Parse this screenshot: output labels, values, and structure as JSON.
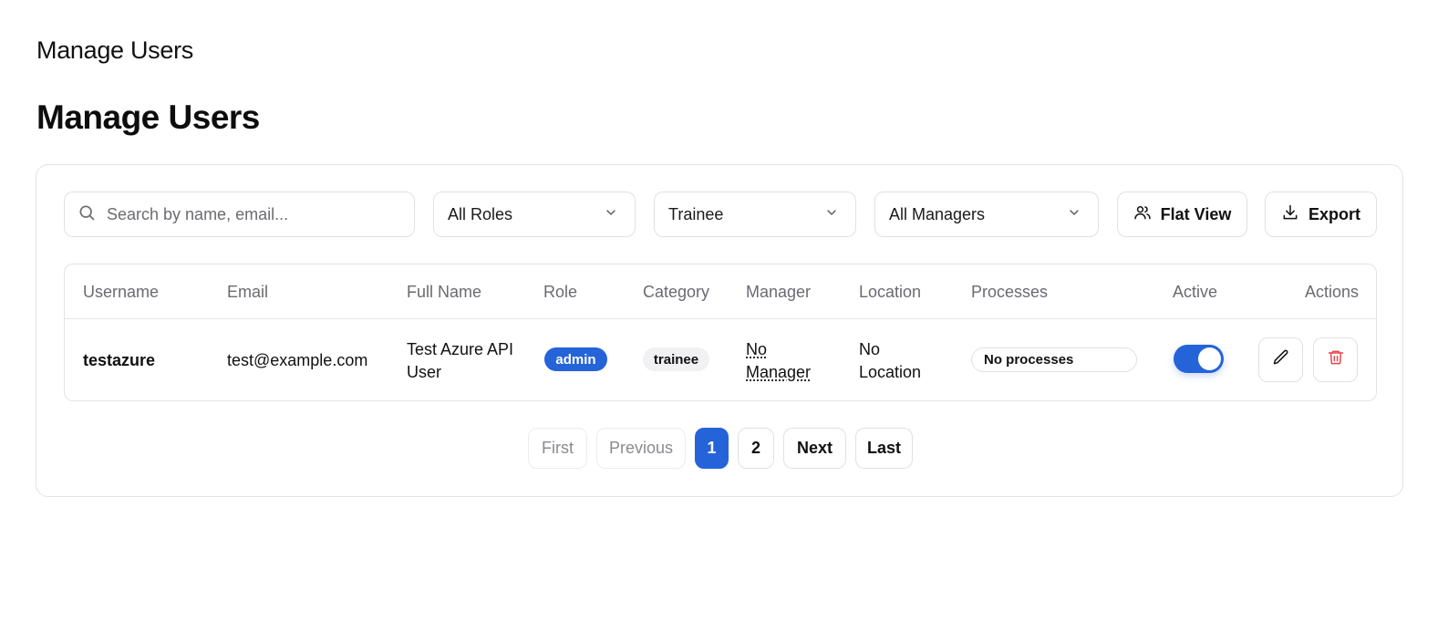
{
  "header": {
    "top_title": "Manage Users",
    "page_heading": "Manage Users"
  },
  "filters": {
    "search_placeholder": "Search by name, email...",
    "role_select": "All Roles",
    "category_select": "Trainee",
    "manager_select": "All Managers",
    "flat_view_label": "Flat View",
    "export_label": "Export"
  },
  "table": {
    "columns": {
      "username": "Username",
      "email": "Email",
      "full_name": "Full Name",
      "role": "Role",
      "category": "Category",
      "manager": "Manager",
      "location": "Location",
      "processes": "Processes",
      "active": "Active",
      "actions": "Actions"
    },
    "rows": [
      {
        "username": "testazure",
        "email": "test@example.com",
        "full_name_line1": "Test Azure API",
        "full_name_line2": "User",
        "role": "admin",
        "category": "trainee",
        "manager_line1": "No",
        "manager_line2": "Manager",
        "location_line1": "No",
        "location_line2": "Location",
        "processes": "No processes",
        "active": true
      }
    ]
  },
  "pagination": {
    "first": "First",
    "previous": "Previous",
    "pages": [
      "1",
      "2"
    ],
    "current_page": "1",
    "next": "Next",
    "last": "Last"
  },
  "colors": {
    "accent": "#2563d9",
    "delete": "#e5484d",
    "muted_text": "#6a6a72",
    "border": "#e1e1e4"
  }
}
